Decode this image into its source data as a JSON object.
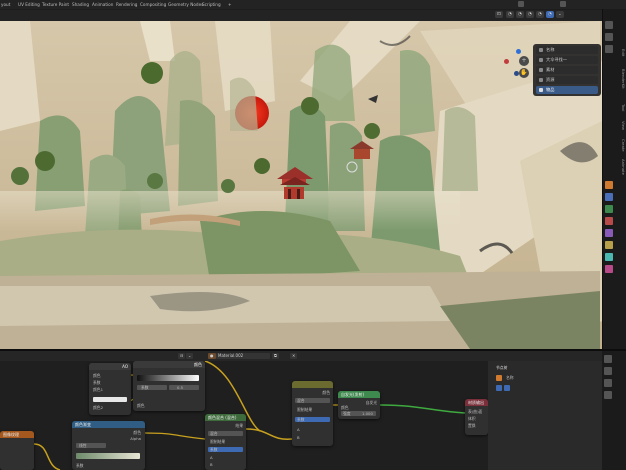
{
  "topbar": {
    "workspace_tabs": [
      "yout",
      "UV Editing",
      "Texture Paint",
      "Shading",
      "Animation",
      "Rendering",
      "Compositing",
      "Geometry Nodes",
      "Scripting"
    ],
    "add_tab": "+"
  },
  "viewport": {
    "header_buttons": [
      "⊡",
      "◔",
      "◔",
      "◔",
      "◔",
      "◔",
      "⌄"
    ],
    "n_panel": {
      "rows": [
        {
          "label": "名称",
          "selected": false
        },
        {
          "label": "大伞寻找一",
          "selected": false
        },
        {
          "label": "素材",
          "selected": false
        },
        {
          "label": "资源",
          "selected": false
        },
        {
          "label": "物品",
          "selected": true
        }
      ]
    },
    "nav_icons": [
      "+",
      "✋",
      "▣",
      "⬚"
    ]
  },
  "sidebar": {
    "vertical_tabs": [
      "Edit",
      "BlenderKit",
      "Tool",
      "View",
      "Create",
      "Animate"
    ]
  },
  "node_editor": {
    "header_buttons": [
      "⊟",
      "⌄",
      "●",
      "Material.002",
      "⧉",
      "✕"
    ],
    "nodes": [
      {
        "id": "orange",
        "title": "图像纹理"
      },
      {
        "id": "mix1",
        "title": "",
        "rows": [
          "颜色",
          "系数",
          "颜色1",
          "颜色2"
        ],
        "value": "AO"
      },
      {
        "id": "ramp",
        "title": "",
        "fields": [
          "系数",
          "0.5",
          "位置"
        ],
        "value": "颜色",
        "bottom": "颜色"
      },
      {
        "id": "blue",
        "title": "颜色渐变",
        "rows": [
          "颜色",
          "Alpha",
          "线性",
          "颜色",
          "系数"
        ]
      },
      {
        "id": "green1",
        "title": "颜色混合 (混合)",
        "rows": [
          "结果",
          "混合",
          "限制结果",
          "系数",
          "A",
          "B"
        ]
      },
      {
        "id": "olive",
        "title": "",
        "rows": [
          "颜色",
          "混合",
          "限制结果",
          "系数",
          "A",
          "B"
        ]
      },
      {
        "id": "shader",
        "title": "自发光(发射)",
        "rows": [
          "颜色",
          "强度",
          "自发光",
          "1.000"
        ]
      },
      {
        "id": "output",
        "title": "材质输出",
        "rows": [
          "全部",
          "表(曲)面",
          "体积",
          "置换"
        ]
      }
    ],
    "side_panel": {
      "title": "节点树",
      "rows": [
        "名称",
        "可见"
      ]
    }
  },
  "colors": {
    "accent": "#3d6ab3",
    "header_orange": "#a4581e",
    "header_blue": "#2f5d83",
    "header_green": "#3e6b3c",
    "header_olive": "#6b6b2f",
    "header_red": "#7a2f3a",
    "wire": "#c7a11e",
    "wire_green": "#3faa3f"
  }
}
